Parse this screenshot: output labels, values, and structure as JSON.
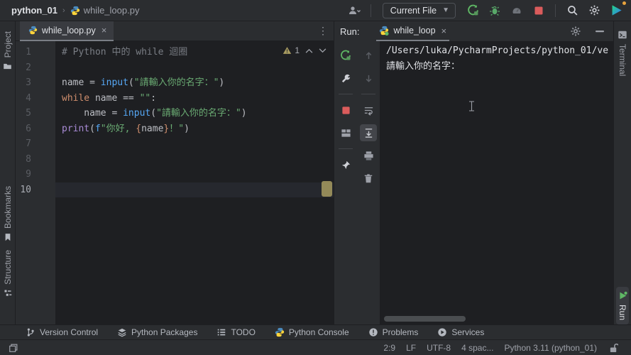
{
  "colors": {
    "keyword": "#CF8E6D",
    "function_call": "#56A8F5",
    "builtin": "#A98BD6",
    "string": "#6AAB73",
    "comment": "#7A7E85",
    "brace": "#CF8E6D",
    "warning": "#A89B60",
    "run_green": "#5FB865",
    "debug_green": "#59A869",
    "stop_red": "#DB5C5C"
  },
  "titlebar": {
    "project": "python_01",
    "separator": "›",
    "file": "while_loop.py",
    "current_file_label": "Current File"
  },
  "left_stripe": {
    "project": "Project",
    "bookmarks": "Bookmarks",
    "structure": "Structure"
  },
  "right_stripe": {
    "terminal": "Terminal",
    "run": "Run"
  },
  "editor": {
    "tab_label": "while_loop.py",
    "tab_close": "×",
    "kebab": "⋮",
    "warning_count": "1",
    "current_line": 10,
    "lines": [
      [
        {
          "t": "# Python 中的 while 迴圈",
          "c": "comment"
        }
      ],
      [],
      [
        {
          "t": "name ",
          "c": "plain"
        },
        {
          "t": "= ",
          "c": "plain"
        },
        {
          "t": "input",
          "c": "func"
        },
        {
          "t": "(",
          "c": "plain"
        },
        {
          "t": "\"請輸入你的名字：\"",
          "c": "string"
        },
        {
          "t": ")",
          "c": "plain"
        }
      ],
      [
        {
          "t": "while ",
          "c": "kw"
        },
        {
          "t": "name ",
          "c": "plain"
        },
        {
          "t": "== ",
          "c": "plain"
        },
        {
          "t": "\"\"",
          "c": "string"
        },
        {
          "t": ":",
          "c": "plain"
        }
      ],
      [
        {
          "t": "    name ",
          "c": "plain"
        },
        {
          "t": "= ",
          "c": "plain"
        },
        {
          "t": "input",
          "c": "func"
        },
        {
          "t": "(",
          "c": "plain"
        },
        {
          "t": "\"請輸入你的名字：\"",
          "c": "string"
        },
        {
          "t": ")",
          "c": "plain"
        }
      ],
      [
        {
          "t": "print",
          "c": "builtin"
        },
        {
          "t": "(",
          "c": "plain"
        },
        {
          "t": "f",
          "c": "func"
        },
        {
          "t": "\"你好, ",
          "c": "string"
        },
        {
          "t": "{",
          "c": "brace"
        },
        {
          "t": "name",
          "c": "plain"
        },
        {
          "t": "}",
          "c": "brace"
        },
        {
          "t": "！\"",
          "c": "string"
        },
        {
          "t": ")",
          "c": "plain"
        }
      ],
      [],
      [],
      [],
      []
    ]
  },
  "run_panel": {
    "title": "Run:",
    "tab_label": "while_loop",
    "tab_close": "×",
    "console_lines": [
      "/Users/luka/PycharmProjects/python_01/ve",
      "請輸入你的名字："
    ]
  },
  "bottom_bar": {
    "items": [
      {
        "label": "Version Control",
        "icon": "branch-icon"
      },
      {
        "label": "Python Packages",
        "icon": "packages-icon"
      },
      {
        "label": "TODO",
        "icon": "todo-icon"
      },
      {
        "label": "Python Console",
        "icon": "python-icon"
      },
      {
        "label": "Problems",
        "icon": "problems-icon"
      },
      {
        "label": "Services",
        "icon": "services-icon"
      }
    ]
  },
  "status_bar": {
    "items": [
      {
        "name": "cursor-position",
        "label": "2:9"
      },
      {
        "name": "line-separator",
        "label": "LF"
      },
      {
        "name": "encoding",
        "label": "UTF-8"
      },
      {
        "name": "indent",
        "label": "4 spac..."
      },
      {
        "name": "interpreter",
        "label": "Python 3.11 (python_01)"
      }
    ]
  }
}
